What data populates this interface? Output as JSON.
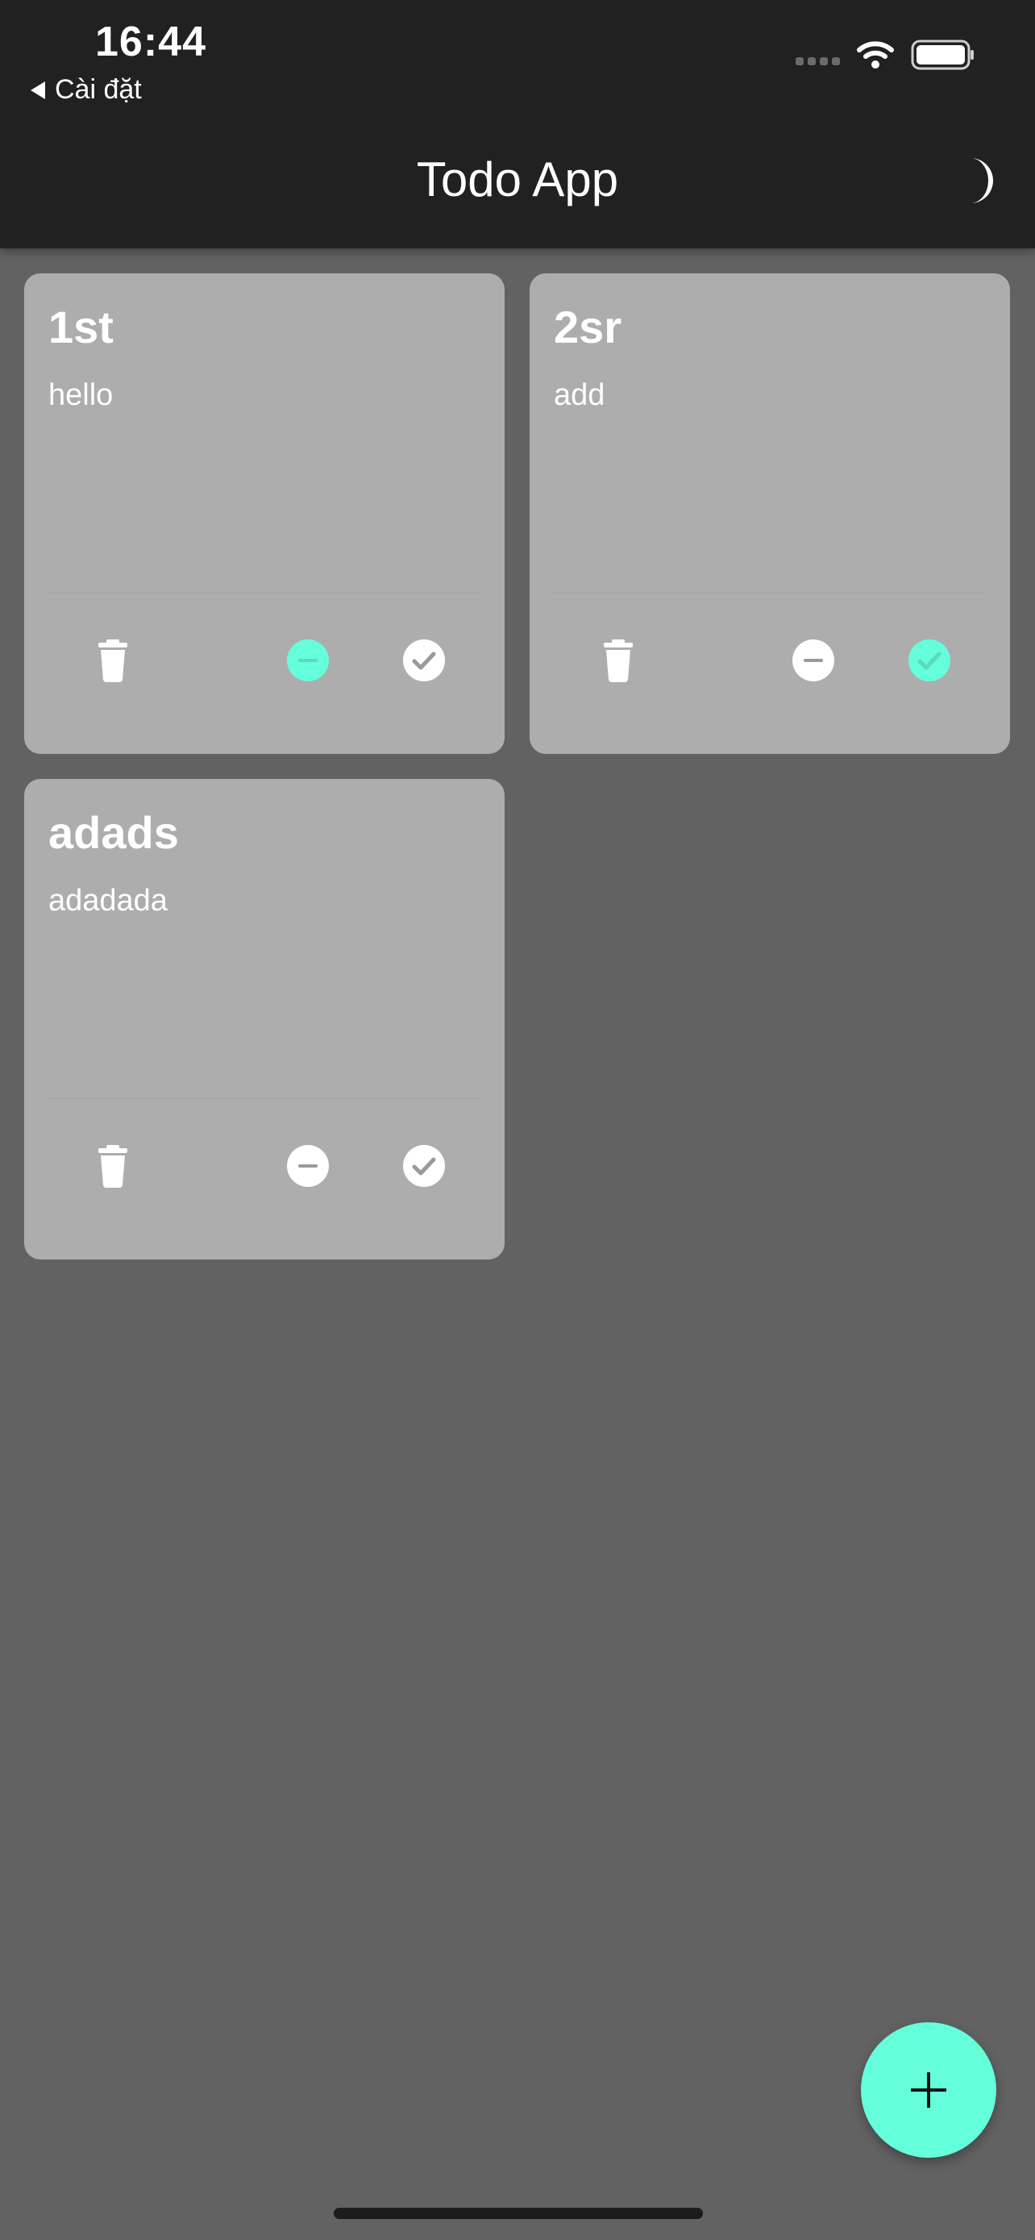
{
  "status_bar": {
    "time": "16:44",
    "back_label": "Cài đặt",
    "icons": [
      "signal-icon",
      "wifi-icon",
      "battery-icon"
    ]
  },
  "app_bar": {
    "title": "Todo App",
    "theme_toggle_icon": "moon-icon"
  },
  "colors": {
    "background": "#626262",
    "app_bar": "#212121",
    "card": "#adadad",
    "accent": "#64ffda",
    "icon": "#ffffff"
  },
  "todos": [
    {
      "title": "1st",
      "body": "hello",
      "in_progress": true,
      "done": false
    },
    {
      "title": "2sr",
      "body": "add",
      "in_progress": false,
      "done": true
    },
    {
      "title": "adads",
      "body": "adadada",
      "in_progress": false,
      "done": false
    }
  ],
  "card_actions": {
    "delete_icon": "trash-icon",
    "progress_icon": "minus-circle-icon",
    "done_icon": "check-circle-icon"
  },
  "fab": {
    "icon": "plus-icon"
  }
}
